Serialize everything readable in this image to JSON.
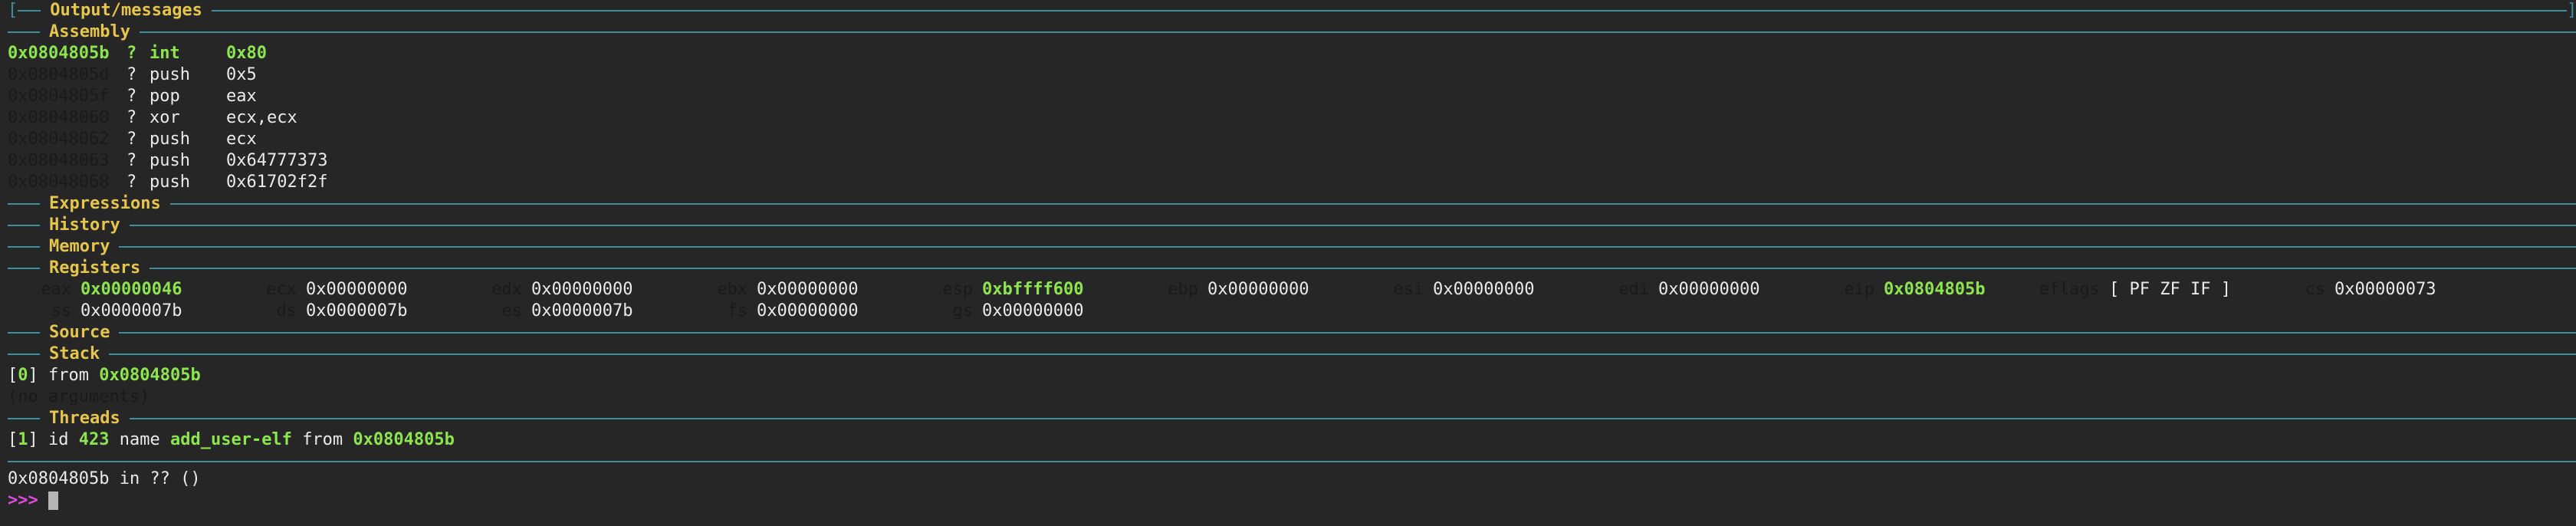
{
  "sections": {
    "output": "Output/messages",
    "assembly": "Assembly",
    "expressions": "Expressions",
    "history": "History",
    "memory": "Memory",
    "registers": "Registers",
    "source": "Source",
    "stack": "Stack",
    "threads": "Threads"
  },
  "assembly": [
    {
      "addr": "0x0804805b",
      "q": "?",
      "op": "int",
      "arg": "0x80",
      "current": true
    },
    {
      "addr": "0x0804805d",
      "q": "?",
      "op": "push",
      "arg": "0x5",
      "current": false
    },
    {
      "addr": "0x0804805f",
      "q": "?",
      "op": "pop",
      "arg": "eax",
      "current": false
    },
    {
      "addr": "0x08048060",
      "q": "?",
      "op": "xor",
      "arg": "ecx,ecx",
      "current": false
    },
    {
      "addr": "0x08048062",
      "q": "?",
      "op": "push",
      "arg": "ecx",
      "current": false
    },
    {
      "addr": "0x08048063",
      "q": "?",
      "op": "push",
      "arg": "0x64777373",
      "current": false
    },
    {
      "addr": "0x08048068",
      "q": "?",
      "op": "push",
      "arg": "0x61702f2f",
      "current": false
    }
  ],
  "registers": {
    "row1": [
      {
        "name": "eax",
        "value": "0x00000046",
        "changed": true
      },
      {
        "name": "ecx",
        "value": "0x00000000",
        "changed": false
      },
      {
        "name": "edx",
        "value": "0x00000000",
        "changed": false
      },
      {
        "name": "ebx",
        "value": "0x00000000",
        "changed": false
      },
      {
        "name": "esp",
        "value": "0xbffff600",
        "changed": true
      },
      {
        "name": "ebp",
        "value": "0x00000000",
        "changed": false
      },
      {
        "name": "esi",
        "value": "0x00000000",
        "changed": false
      },
      {
        "name": "edi",
        "value": "0x00000000",
        "changed": false
      },
      {
        "name": "eip",
        "value": "0x0804805b",
        "changed": true
      },
      {
        "name": "eflags",
        "value": "[ PF ZF IF ]",
        "changed": false
      },
      {
        "name": "cs",
        "value": "0x00000073",
        "changed": false
      }
    ],
    "row2": [
      {
        "name": "ss",
        "value": "0x0000007b",
        "changed": false
      },
      {
        "name": "ds",
        "value": "0x0000007b",
        "changed": false
      },
      {
        "name": "es",
        "value": "0x0000007b",
        "changed": false
      },
      {
        "name": "fs",
        "value": "0x00000000",
        "changed": false
      },
      {
        "name": "gs",
        "value": "0x00000000",
        "changed": false
      }
    ]
  },
  "stack": {
    "frame_index": "0",
    "from_label": "from",
    "frame_addr": "0x0804805b",
    "args": "(no arguments)"
  },
  "threads": {
    "index": "1",
    "id_label": "id",
    "id": "423",
    "name_label": "name",
    "name": "add_user-elf",
    "from_label": "from",
    "addr": "0x0804805b"
  },
  "status_line": "0x0804805b in ?? ()",
  "prompt": ">>>",
  "colors": {
    "background": "#262626",
    "rule": "#3c8fa0",
    "section_title": "#e5c54c",
    "changed": "#8ce54e",
    "prompt": "#e24ae0"
  }
}
